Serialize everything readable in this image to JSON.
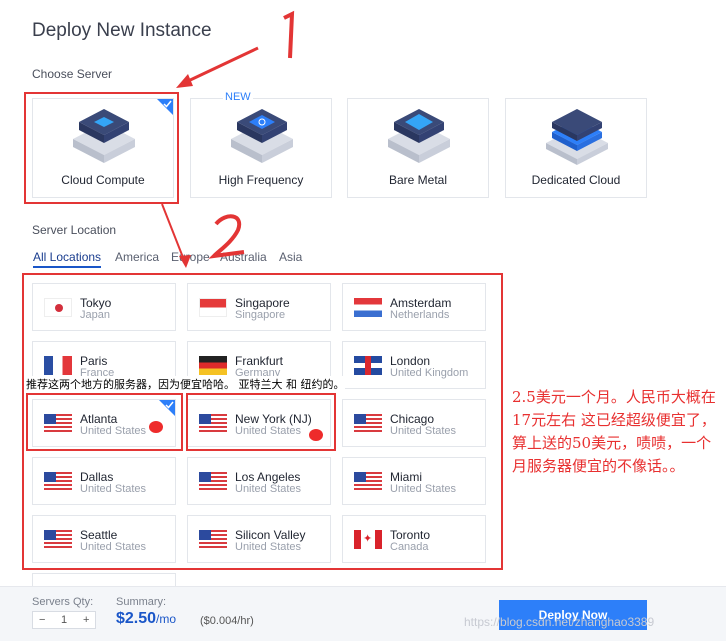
{
  "page_title": "Deploy New Instance",
  "choose_server_label": "Choose Server",
  "server_types": [
    {
      "label": "Cloud Compute",
      "selected": true,
      "badge": ""
    },
    {
      "label": "High Frequency",
      "selected": false,
      "badge": "NEW"
    },
    {
      "label": "Bare Metal",
      "selected": false,
      "badge": ""
    },
    {
      "label": "Dedicated Cloud",
      "selected": false,
      "badge": ""
    }
  ],
  "server_location_label": "Server Location",
  "location_tabs": [
    "All Locations",
    "America",
    "Europe",
    "Australia",
    "Asia"
  ],
  "locations": [
    {
      "city": "Tokyo",
      "country": "Japan",
      "flag": "flag-jp"
    },
    {
      "city": "Singapore",
      "country": "Singapore",
      "flag": "flag-sg"
    },
    {
      "city": "Amsterdam",
      "country": "Netherlands",
      "flag": "flag-nl"
    },
    {
      "city": "Paris",
      "country": "France",
      "flag": "flag-fr"
    },
    {
      "city": "Frankfurt",
      "country": "Germany",
      "flag": "flag-de"
    },
    {
      "city": "London",
      "country": "United Kingdom",
      "flag": "flag-uk"
    },
    {
      "city": "Atlanta",
      "country": "United States",
      "flag": "flag-us"
    },
    {
      "city": "New York (NJ)",
      "country": "United States",
      "flag": "flag-us"
    },
    {
      "city": "Chicago",
      "country": "United States",
      "flag": "flag-us"
    },
    {
      "city": "Dallas",
      "country": "United States",
      "flag": "flag-us"
    },
    {
      "city": "Los Angeles",
      "country": "United States",
      "flag": "flag-us"
    },
    {
      "city": "Miami",
      "country": "United States",
      "flag": "flag-us"
    },
    {
      "city": "Seattle",
      "country": "United States",
      "flag": "flag-us"
    },
    {
      "city": "Silicon Valley",
      "country": "United States",
      "flag": "flag-us"
    },
    {
      "city": "Toronto",
      "country": "Canada",
      "flag": "flag-ca"
    }
  ],
  "annotations": {
    "number_1": "1",
    "number_2": "2",
    "note_recommend": "推荐这两个地方的服务器，因为便宜哈哈。 亚特兰大 和 纽约的。",
    "note_price": "2.5美元一个月。人民币大概在17元左右 这已经超级便宜了，算上送的50美元，啧啧，一个月服务器便宜的不像话。。"
  },
  "bottom_bar": {
    "qty_label": "Servers Qty:",
    "qty_minus": "−",
    "qty_value": "1",
    "qty_plus": "+",
    "summary_label": "Summary:",
    "price": "$2.50",
    "price_unit": "/mo",
    "hourly": "($0.004/hr)",
    "deploy_label": "Deploy Now"
  },
  "watermark": "https://blog.csdn.net/zhanghao3389",
  "colors": {
    "accent": "#2d7ff9",
    "annotation": "#e33535"
  }
}
